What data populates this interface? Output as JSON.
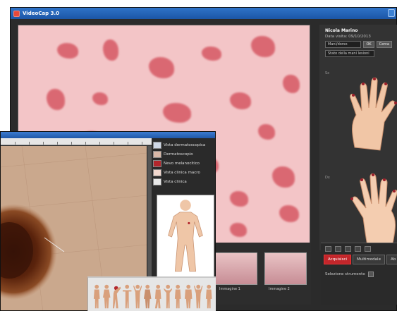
{
  "app": {
    "title": "VideoCap 3.0"
  },
  "patient": {
    "name": "Nicola Marino",
    "date": "Data visita: 09/10/2013",
    "view_select": "Mani/dorso",
    "apply_label": "OK",
    "side_btn": "Cerca",
    "report_select": "Stato della mani lesioni"
  },
  "sides": {
    "first": "Sx",
    "second": "Dx"
  },
  "thumbnails": [
    {
      "label": "Immagine 1"
    },
    {
      "label": "Immagine 2"
    }
  ],
  "tabs": {
    "items": [
      {
        "label": "Acquisisci"
      },
      {
        "label": "Multimodale"
      },
      {
        "label": "Ab"
      }
    ],
    "field_label": "Selezione strumento"
  },
  "legend": {
    "items": [
      {
        "label": "Vista dermatoscopica",
        "color": "#cfd8e6"
      },
      {
        "label": "Dermatoscopio",
        "color": "#d9b8a8"
      },
      {
        "label": "Nevo melanocitico",
        "color": "#b3262c"
      },
      {
        "label": "Vista clinica macro",
        "color": "#f2d8cf"
      },
      {
        "label": "Vista clinica",
        "color": "#e8e8e8"
      }
    ]
  },
  "colors": {
    "accent": "#c3262b",
    "title_bar": "#2f73c8",
    "skin_pink": "#f3c5c7",
    "mole_brown": "#4a1c0b"
  },
  "icons": [
    "app-icon",
    "window-button-icon",
    "thumbnail-toolbar-icons",
    "hand-dorsal-image",
    "hand-palmar-image",
    "body-map-figure",
    "body-pose-figures"
  ]
}
